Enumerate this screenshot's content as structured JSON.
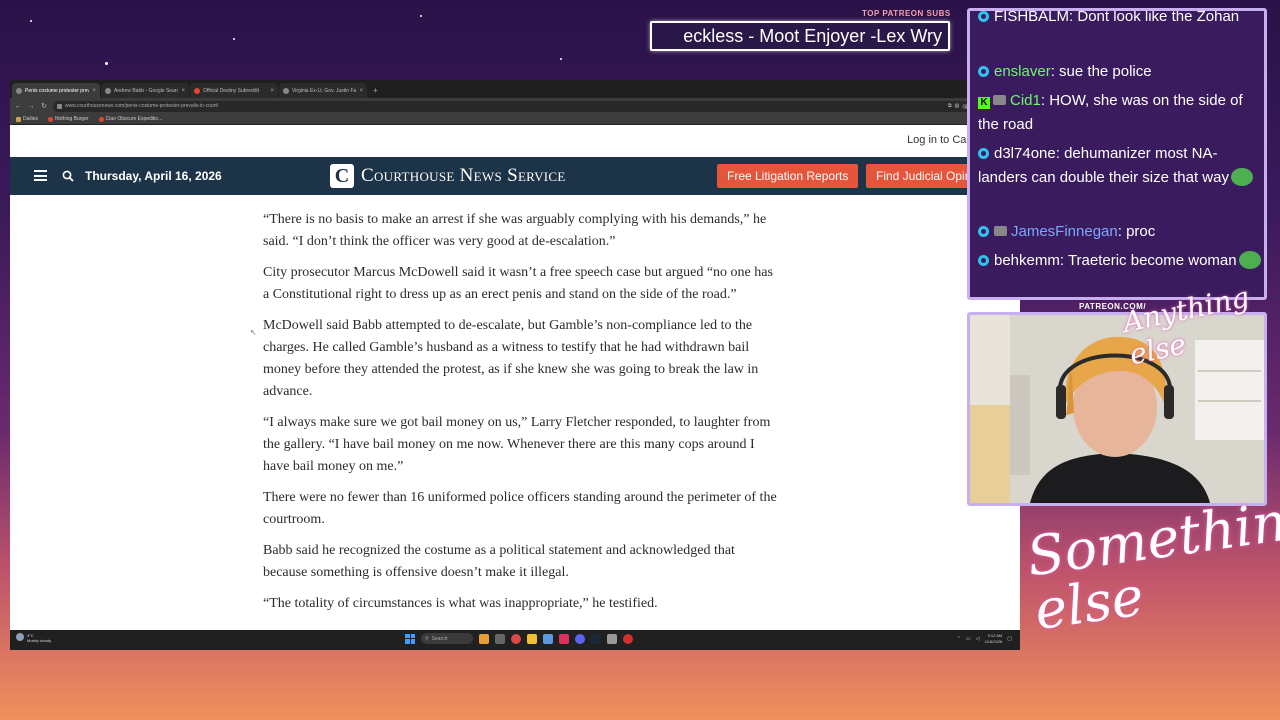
{
  "browser": {
    "tabs": [
      {
        "label": "Penis costume protester prevails",
        "active": true
      },
      {
        "label": "Andrew Babb - Google Search",
        "active": false
      },
      {
        "label": "Official Destiny Subreddit",
        "active": false
      },
      {
        "label": "Virginia Ex-Lt. Gov. Justin Fairfa",
        "active": false
      }
    ],
    "url": "www.courthousenews.com/penis-costume-protester-prevails-in-court/",
    "zoom": "200%",
    "bookmarks": [
      "Dailies",
      "Nothing Burger",
      "Ciao Obscure Expeditio..."
    ]
  },
  "site": {
    "login": "Log in to Case",
    "date": "Thursday, April 16, 2026",
    "logo_mark": "C",
    "logo_text": "Courthouse News Service",
    "btn_reports": "Free Litigation Reports",
    "btn_opinions": "Find Judicial Opinions"
  },
  "article": {
    "paragraphs": [
      "“There is no basis to make an arrest if she was arguably complying with his demands,” he said. “I don’t think the officer was very good at de-escalation.”",
      "City prosecutor Marcus McDowell said it wasn’t a free speech case but argued “no one has a Constitutional right to dress up as an erect penis and stand on the side of the road.”",
      "McDowell said Babb attempted to de-escalate, but Gamble’s non-compliance led to the charges. He called Gamble’s husband as a witness to testify that he had withdrawn bail money before they attended the protest, as if she knew she was going to break the law in advance.",
      "“I always make sure we got bail money on us,” Larry Fletcher responded, to laughter from the gallery. “I have bail money on me now. Whenever there are this many cops around I have bail money on me.”",
      "There were no fewer than 16 uniformed police officers standing around the perimeter of the courtroom.",
      "Babb said he recognized the costume as a political statement and acknowledged that because something is offensive doesn’t make it illegal.",
      "“The totality of circumstances is what was inappropriate,” he testified."
    ]
  },
  "taskbar": {
    "weather_temp": "4°C",
    "weather_desc": "Mostly cloudy",
    "search": "Search",
    "time": "9:12 AM",
    "date": "4/16/2026"
  },
  "overlay": {
    "patreon_label": "TOP PATREON SUBS",
    "ticker": "eckless - Moot Enjoyer -Lex Wry",
    "cam_label": "PATREON.COM/",
    "cam_script": "Anything else",
    "big_script": "Something else"
  },
  "chat": [
    {
      "user": "FISHBALM",
      "text": "Dont look like the Zohan",
      "user_color": "#ffffff"
    },
    {
      "user": "enslaver",
      "text": "sue the police",
      "user_color": "#6ef76e"
    },
    {
      "user": "Cid1",
      "text": "HOW, she was on the side of the road",
      "user_color": "#6ef76e"
    },
    {
      "user": "d3l74one",
      "text": "dehumanizer most NA-landers can double their size that way",
      "user_color": "#ffffff"
    },
    {
      "user": "JamesFinnegan",
      "text": "proc",
      "user_color": "#7aa8ff"
    },
    {
      "user": "behkemm",
      "text": "Traeteric become woman",
      "user_color": "#ffffff"
    }
  ]
}
